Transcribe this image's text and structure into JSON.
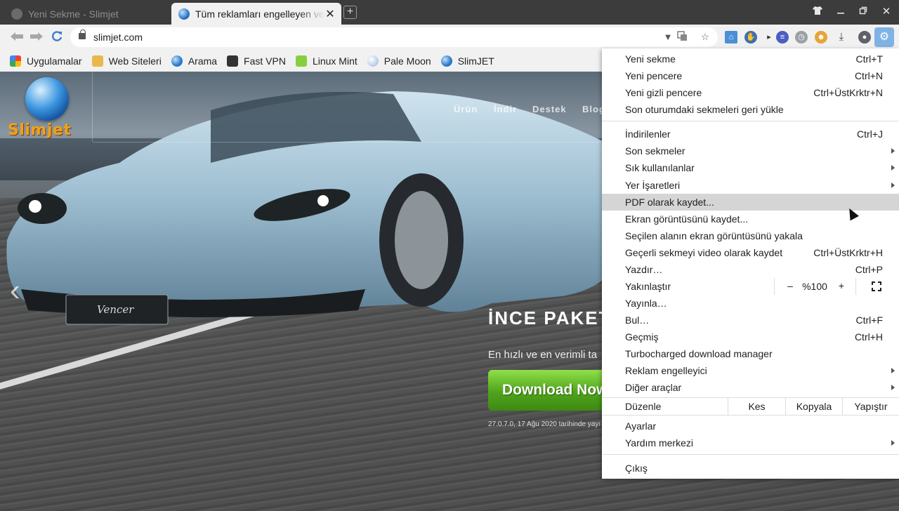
{
  "tabs": [
    {
      "title": "Yeni Sekme - Slimjet",
      "state": "inactive"
    },
    {
      "title": "Tüm reklamları engelleyen ve",
      "state": "active"
    }
  ],
  "toolbar": {
    "url": "slimjet.com",
    "icons": [
      "back-icon",
      "forward-icon",
      "reload-icon",
      "lock-icon",
      "dropdown-icon",
      "translate-icon",
      "star-icon",
      "home-icon",
      "adblock-icon",
      "extension-icon",
      "profile-icon",
      "download-icon",
      "avatar-icon",
      "settings-icon"
    ]
  },
  "bookmarks": [
    {
      "label": "Uygulamalar",
      "icon": "apps-grid-icon"
    },
    {
      "label": "Web Siteleri",
      "icon": "folder-icon"
    },
    {
      "label": "Arama",
      "icon": "globe-icon"
    },
    {
      "label": "Fast VPN",
      "icon": "vpn-icon"
    },
    {
      "label": "Linux Mint",
      "icon": "mint-icon"
    },
    {
      "label": "Pale Moon",
      "icon": "moon-icon"
    },
    {
      "label": "SlimJET",
      "icon": "globe-icon"
    }
  ],
  "site": {
    "logo": "Slimjet",
    "nav": [
      "Ürün",
      "İndir",
      "Destek",
      "Blog"
    ],
    "hero_title": "İNCE PAKET",
    "hero_sub": "En hızlı ve en verimli ta",
    "download_label": "Download Now",
    "version_line": "27.0.7.0, 17 Ağu 2020 tarihinde yayı",
    "car_plate": "Vencer"
  },
  "menu": {
    "items": [
      {
        "label": "Yeni sekme",
        "shortcut": "Ctrl+T"
      },
      {
        "label": "Yeni pencere",
        "shortcut": "Ctrl+N"
      },
      {
        "label": "Yeni gizli pencere",
        "shortcut": "Ctrl+ÜstKrktr+N"
      },
      {
        "label": "Son oturumdaki sekmeleri geri yükle",
        "shortcut": ""
      },
      {
        "label": "İndirilenler",
        "shortcut": "Ctrl+J"
      },
      {
        "label": "Son sekmeler",
        "shortcut": ""
      },
      {
        "label": "Sık kullanılanlar",
        "shortcut": ""
      },
      {
        "label": "Yer İşaretleri",
        "shortcut": ""
      },
      {
        "label": "PDF olarak kaydet...",
        "shortcut": ""
      },
      {
        "label": "Ekran görüntüsünü kaydet...",
        "shortcut": ""
      },
      {
        "label": "Seçilen alanın ekran görüntüsünü yakala",
        "shortcut": ""
      },
      {
        "label": "Geçerli sekmeyi video olarak kaydet",
        "shortcut": "Ctrl+ÜstKrktr+H"
      },
      {
        "label": "Yazdır…",
        "shortcut": "Ctrl+P"
      },
      {
        "label": "Yakınlaştır",
        "shortcut": ""
      },
      {
        "label": "Yayınla…",
        "shortcut": ""
      },
      {
        "label": "Bul…",
        "shortcut": "Ctrl+F"
      },
      {
        "label": "Geçmiş",
        "shortcut": "Ctrl+H"
      },
      {
        "label": "Turbocharged download manager",
        "shortcut": ""
      },
      {
        "label": "Reklam engelleyici",
        "shortcut": ""
      },
      {
        "label": "Diğer araçlar",
        "shortcut": ""
      },
      {
        "label": "Düzenle",
        "shortcut": ""
      },
      {
        "label": "Ayarlar",
        "shortcut": ""
      },
      {
        "label": "Yardım merkezi",
        "shortcut": ""
      },
      {
        "label": "Çıkış",
        "shortcut": ""
      }
    ],
    "zoom": {
      "minus": "–",
      "value": "%100",
      "plus": "+"
    },
    "edit": {
      "cut": "Kes",
      "copy": "Kopyala",
      "paste": "Yapıştır"
    },
    "highlighted": "PDF olarak kaydet..."
  }
}
